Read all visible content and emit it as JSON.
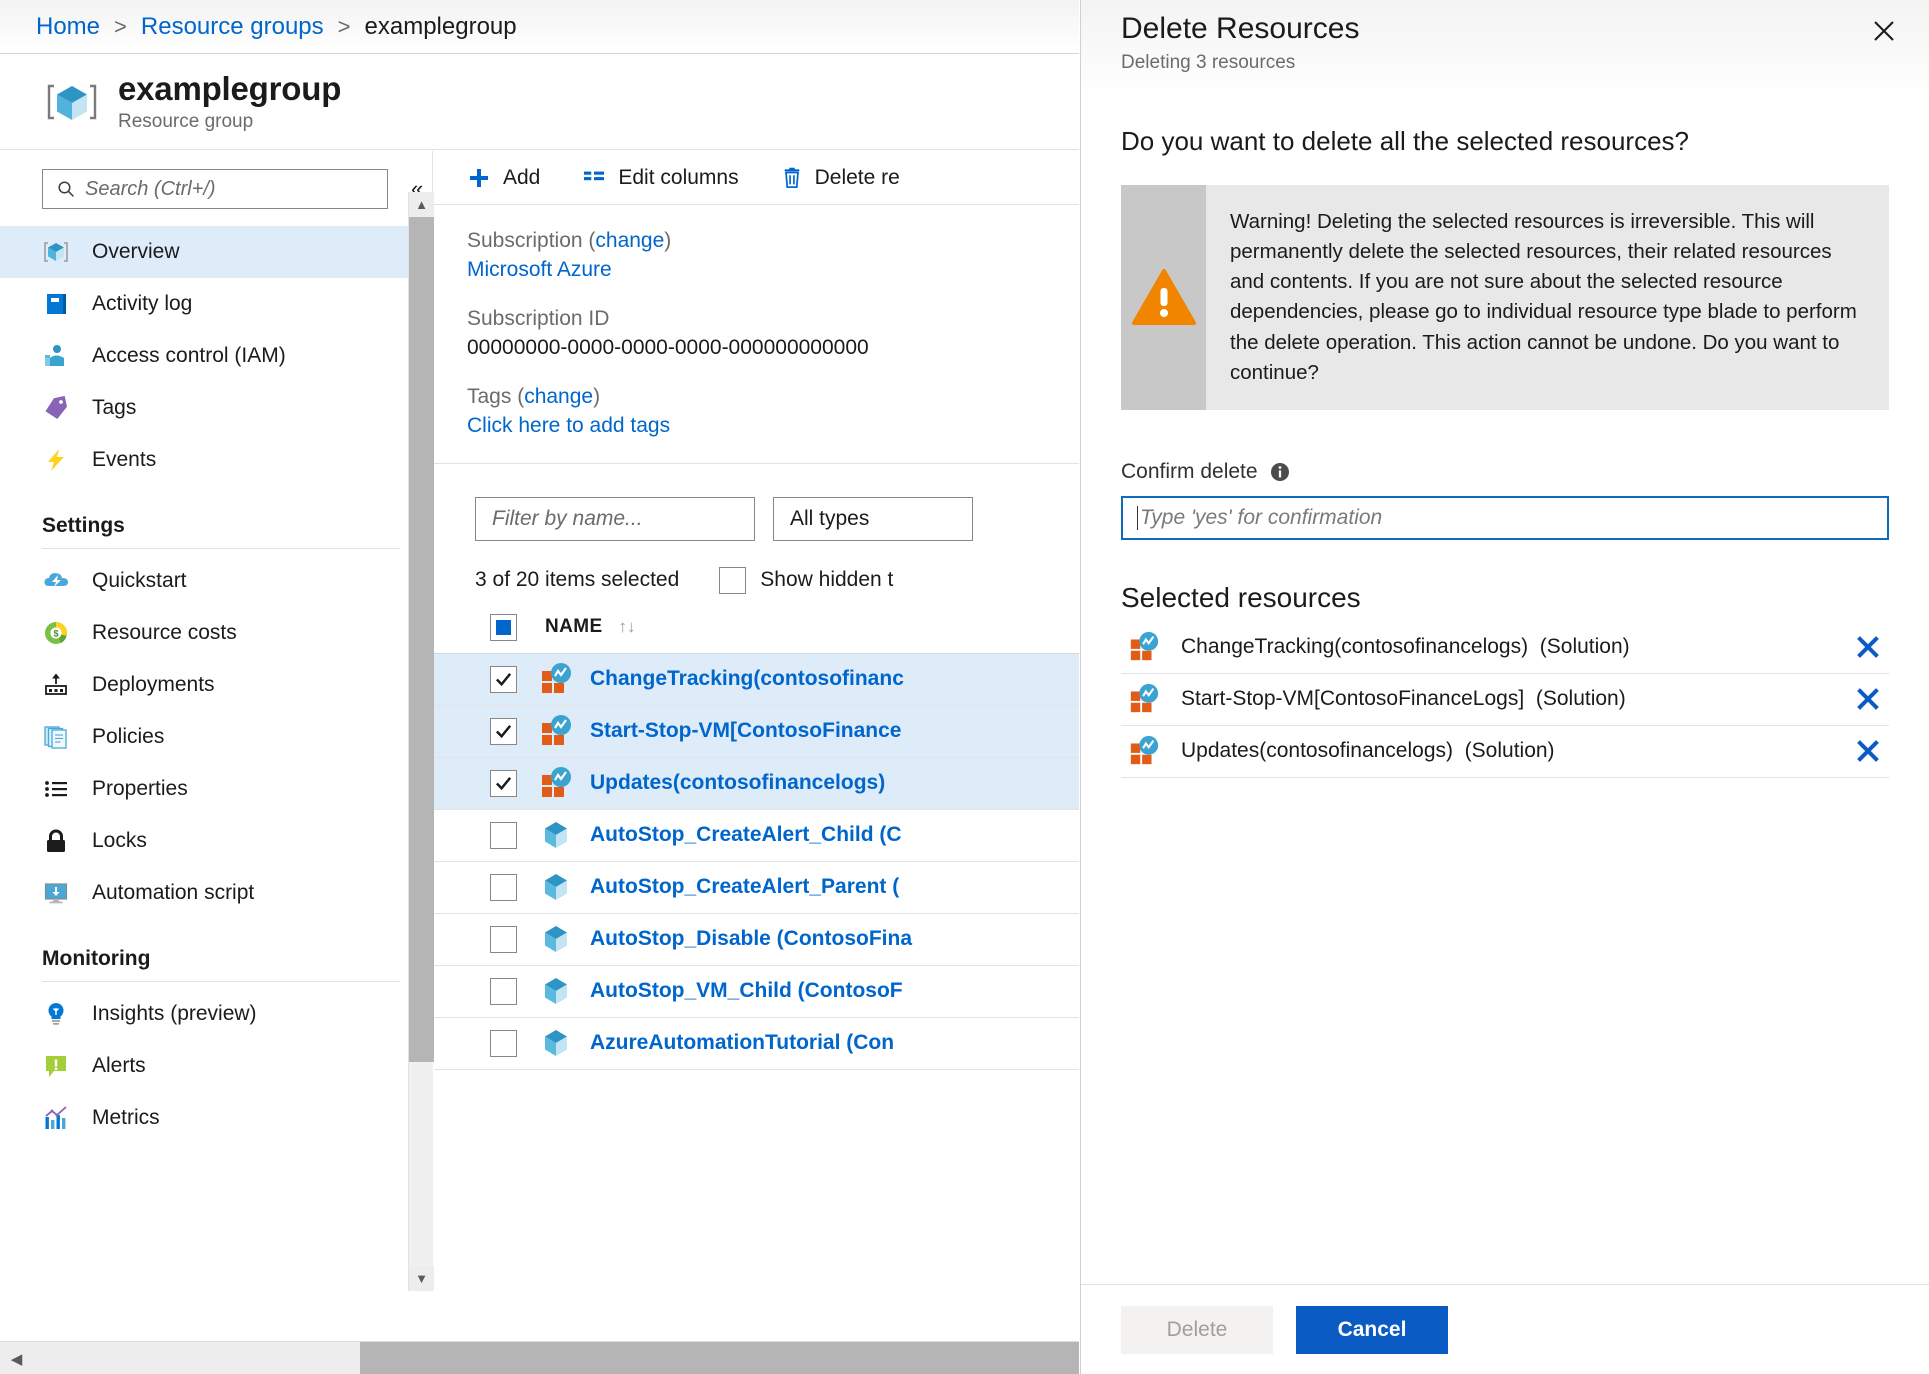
{
  "breadcrumb": {
    "home": "Home",
    "resource_groups": "Resource groups",
    "current": "examplegroup",
    "separator": ">"
  },
  "header": {
    "title": "examplegroup",
    "subtitle": "Resource group"
  },
  "sidebar": {
    "search_placeholder": "Search (Ctrl+/)",
    "collapse_label": "«",
    "items": [
      {
        "label": "Overview",
        "icon": "resource-group-cube-icon",
        "selected": true
      },
      {
        "label": "Activity log",
        "icon": "activity-log-icon",
        "selected": false
      },
      {
        "label": "Access control (IAM)",
        "icon": "access-control-icon",
        "selected": false
      },
      {
        "label": "Tags",
        "icon": "tag-icon",
        "selected": false
      },
      {
        "label": "Events",
        "icon": "lightning-bolt-icon",
        "selected": false
      }
    ],
    "groups": [
      {
        "title": "Settings",
        "items": [
          {
            "label": "Quickstart",
            "icon": "cloud-lightning-icon"
          },
          {
            "label": "Resource costs",
            "icon": "cost-donut-icon"
          },
          {
            "label": "Deployments",
            "icon": "deployments-icon"
          },
          {
            "label": "Policies",
            "icon": "policies-documents-icon"
          },
          {
            "label": "Properties",
            "icon": "properties-list-icon"
          },
          {
            "label": "Locks",
            "icon": "lock-icon"
          },
          {
            "label": "Automation script",
            "icon": "automation-script-icon"
          }
        ]
      },
      {
        "title": "Monitoring",
        "items": [
          {
            "label": "Insights (preview)",
            "icon": "lightbulb-icon"
          },
          {
            "label": "Alerts",
            "icon": "alert-icon"
          },
          {
            "label": "Metrics",
            "icon": "metrics-chart-icon"
          }
        ]
      }
    ]
  },
  "toolbar": {
    "add_label": "Add",
    "edit_columns_label": "Edit columns",
    "delete_label": "Delete re"
  },
  "essentials": {
    "subscription_label": "Subscription",
    "subscription_change": "change",
    "subscription_value": "Microsoft Azure",
    "subscription_id_label": "Subscription ID",
    "subscription_id_value": "00000000-0000-0000-0000-000000000000",
    "tags_label": "Tags",
    "tags_change": "change",
    "tags_value": "Click here to add tags"
  },
  "filters": {
    "name_placeholder": "Filter by name...",
    "type_value": "All types"
  },
  "list": {
    "selection_summary": "3 of 20 items selected",
    "show_hidden_label": "Show hidden t",
    "show_hidden_checked": false,
    "column_name": "NAME",
    "sort_icon": "↑↓",
    "rows": [
      {
        "name": "ChangeTracking(contosofinanc",
        "icon": "solution-icon",
        "checked": true
      },
      {
        "name": "Start-Stop-VM[ContosoFinance",
        "icon": "solution-icon",
        "checked": true
      },
      {
        "name": "Updates(contosofinancelogs)",
        "icon": "solution-icon",
        "checked": true
      },
      {
        "name": "AutoStop_CreateAlert_Child (C",
        "icon": "cube-icon",
        "checked": false
      },
      {
        "name": "AutoStop_CreateAlert_Parent (",
        "icon": "cube-icon",
        "checked": false
      },
      {
        "name": "AutoStop_Disable (ContosoFina",
        "icon": "cube-icon",
        "checked": false
      },
      {
        "name": "AutoStop_VM_Child (ContosoF",
        "icon": "cube-icon",
        "checked": false
      },
      {
        "name": "AzureAutomationTutorial (Con",
        "icon": "cube-icon",
        "checked": false
      }
    ]
  },
  "panel": {
    "title": "Delete Resources",
    "subtitle": "Deleting 3 resources",
    "close_icon": "close-icon",
    "question": "Do you want to delete all the selected resources?",
    "warning_icon": "warning-triangle-icon",
    "warning_text": "Warning! Deleting the selected resources is irreversible. This will permanently delete the selected resources, their related resources and contents. If you are not sure about the selected resource dependencies, please go to individual resource type blade to perform the delete operation. This action cannot be undone. Do you want to continue?",
    "confirm_label": "Confirm delete",
    "confirm_info_icon": "info-icon",
    "confirm_placeholder": "Type 'yes' for confirmation",
    "confirm_value": "",
    "selected_resources_title": "Selected resources",
    "selected_resources": [
      {
        "name": "ChangeTracking(contosofinancelogs)",
        "type": "(Solution)",
        "icon": "solution-icon",
        "remove_icon": "remove-x-icon"
      },
      {
        "name": "Start-Stop-VM[ContosoFinanceLogs]",
        "type": "(Solution)",
        "icon": "solution-icon",
        "remove_icon": "remove-x-icon"
      },
      {
        "name": "Updates(contosofinancelogs)",
        "type": "(Solution)",
        "icon": "solution-icon",
        "remove_icon": "remove-x-icon"
      }
    ],
    "delete_button": "Delete",
    "cancel_button": "Cancel"
  },
  "colors": {
    "link": "#0066cc",
    "primary_button": "#0a5bc4",
    "selection_row": "#deecf9",
    "warning_orange": "#f28500",
    "warning_bg": "#e8e8e8"
  }
}
